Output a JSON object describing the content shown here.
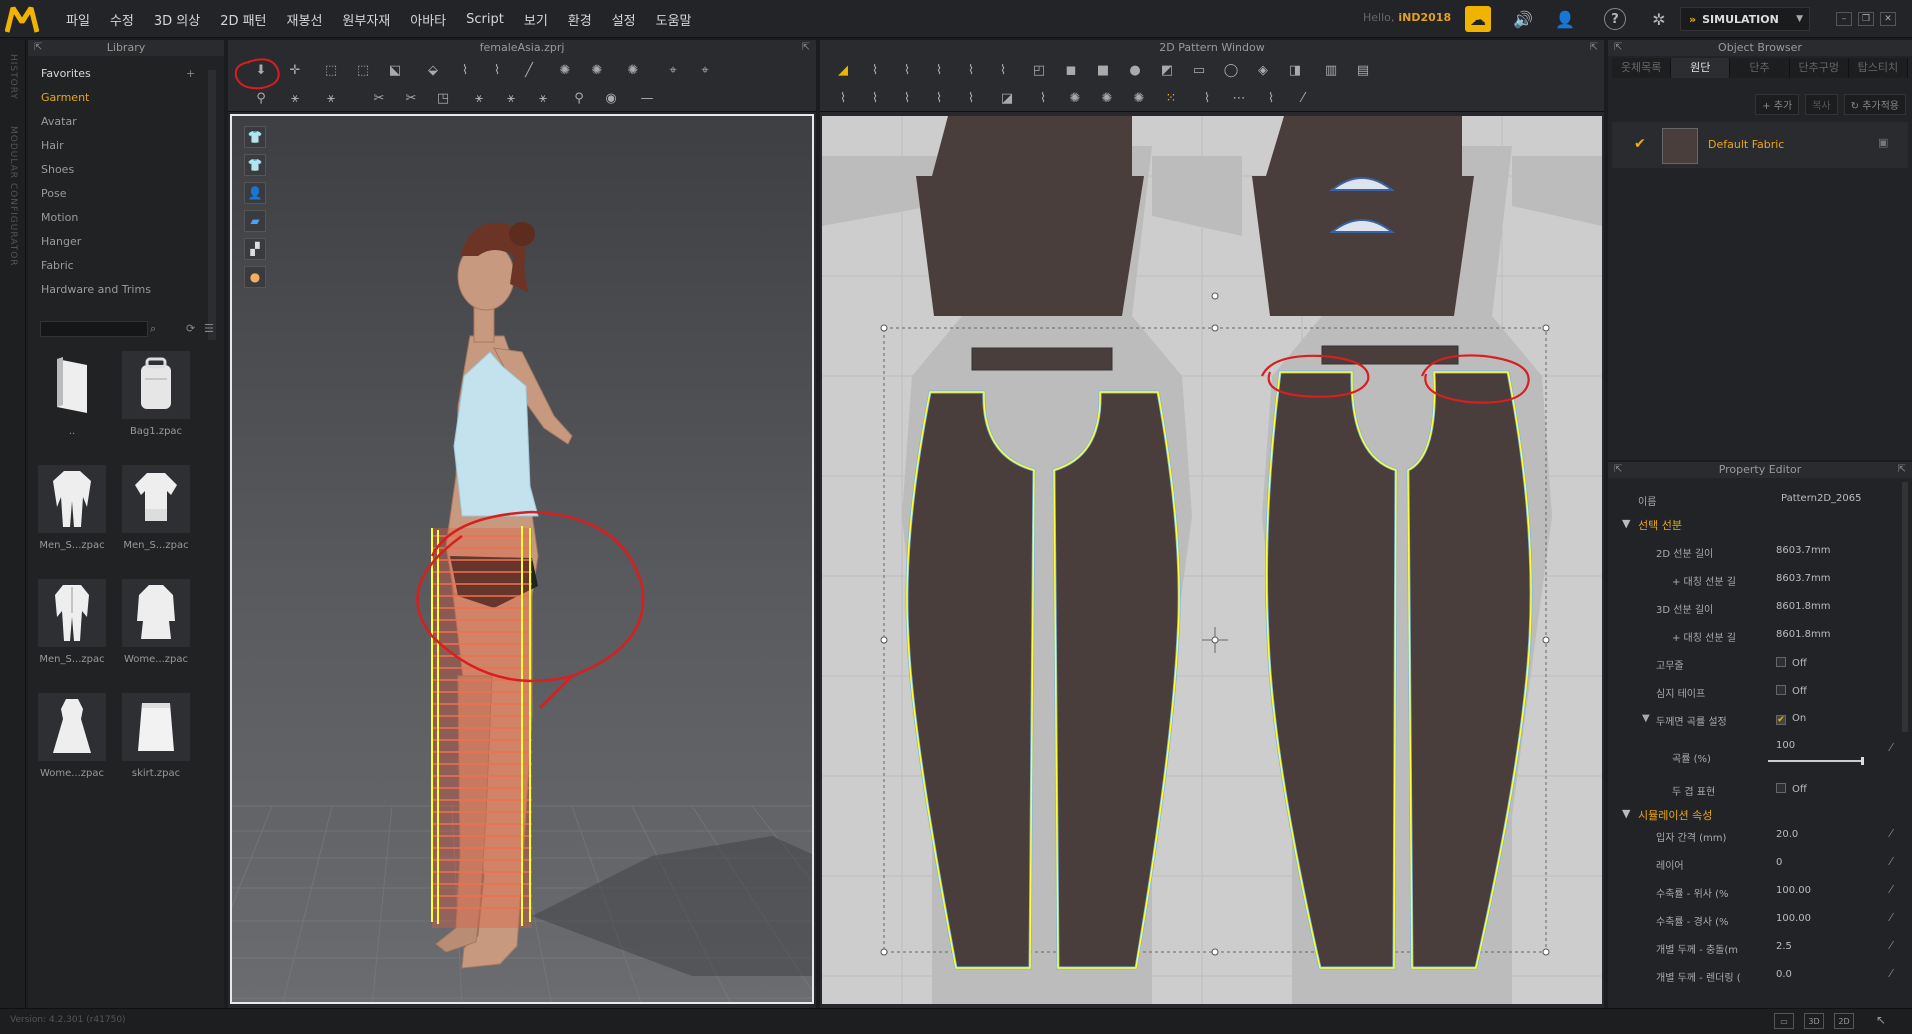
{
  "app": {
    "logo": "M",
    "hello_prefix": "Hello,",
    "username": "iND2018",
    "mode": "SIMULATION"
  },
  "menu": [
    "파일",
    "수정",
    "3D 의상",
    "2D 패턴",
    "재봉선",
    "원부자재",
    "아바타",
    "Script",
    "보기",
    "환경",
    "설정",
    "도움말"
  ],
  "side_strip": {
    "history": "HISTORY",
    "modular": "MODULAR CONFIGURATOR"
  },
  "library": {
    "title": "Library",
    "tree": [
      "Favorites",
      "Garment",
      "Avatar",
      "Hair",
      "Shoes",
      "Pose",
      "Motion",
      "Hanger",
      "Fabric",
      "Hardware and Trims"
    ],
    "active": "Garment",
    "items": [
      {
        "name": "..",
        "icon": "folder-icon"
      },
      {
        "name": "Bag1.zpac",
        "icon": "bag-icon"
      },
      {
        "name": "Men_S...zpac",
        "icon": "suit-icon"
      },
      {
        "name": "Men_S...zpac",
        "icon": "shirt-icon"
      },
      {
        "name": "Men_S...zpac",
        "icon": "suit-icon"
      },
      {
        "name": "Wome...zpac",
        "icon": "coat-icon"
      },
      {
        "name": "Wome...zpac",
        "icon": "dress-icon"
      },
      {
        "name": "skirt.zpac",
        "icon": "skirt-icon"
      }
    ]
  },
  "window3d": {
    "title": "femaleAsia.zprj"
  },
  "window2d": {
    "title": "2D Pattern Window"
  },
  "object_browser": {
    "title": "Object Browser",
    "tabs": [
      "옷체목록",
      "원단",
      "단추",
      "단추구멍",
      "탑스티치"
    ],
    "active_tab": "원단",
    "add_label": "+ 추가",
    "copy_label": "복사",
    "apply_label": "추가적용",
    "fabric_name": "Default Fabric"
  },
  "property_editor": {
    "title": "Property Editor",
    "name_label": "이름",
    "name_value": "Pattern2D_2065",
    "section1": "선택 선분",
    "rows1": [
      {
        "label": "2D 선분 길이",
        "value": "8603.7mm"
      },
      {
        "label": "+ 대칭 선분 길",
        "value": "8603.7mm"
      },
      {
        "label": "3D 선분 길이",
        "value": "8601.8mm"
      },
      {
        "label": "+ 대칭 선분 길",
        "value": "8601.8mm"
      }
    ],
    "elastic_label": "고무줄",
    "elastic_value": "Off",
    "tape_label": "심지 테이프",
    "tape_value": "Off",
    "curve_section": "두께면 곡률 설정",
    "curve_value": "On",
    "curvature_label": "곡률 (%)",
    "curvature_value": "100",
    "curvature_level": 100,
    "thick_label": "두 겹 표현",
    "thick_value": "Off",
    "section2": "시뮬레이션 속성",
    "rows2": [
      {
        "label": "입자 간격 (mm)",
        "value": "20.0"
      },
      {
        "label": "레이어",
        "value": "0"
      },
      {
        "label": "수축률 - 위사 (%",
        "value": "100.00"
      },
      {
        "label": "수축률 - 경사 (%",
        "value": "100.00"
      },
      {
        "label": "개별 두께 - 충돌(m",
        "value": "2.5"
      },
      {
        "label": "개별 두께 - 렌더링 (",
        "value": "0.0"
      }
    ]
  },
  "status": {
    "version": "Version: 4.2.301 (r41750)",
    "views": [
      "▭",
      "3D",
      "2D"
    ]
  },
  "colors": {
    "accent": "#f0b400",
    "pattern_fill": "#4a3e3c",
    "selection": "#ffff33",
    "annotation": "#d81e1e",
    "outline": "#7fb6e0"
  }
}
